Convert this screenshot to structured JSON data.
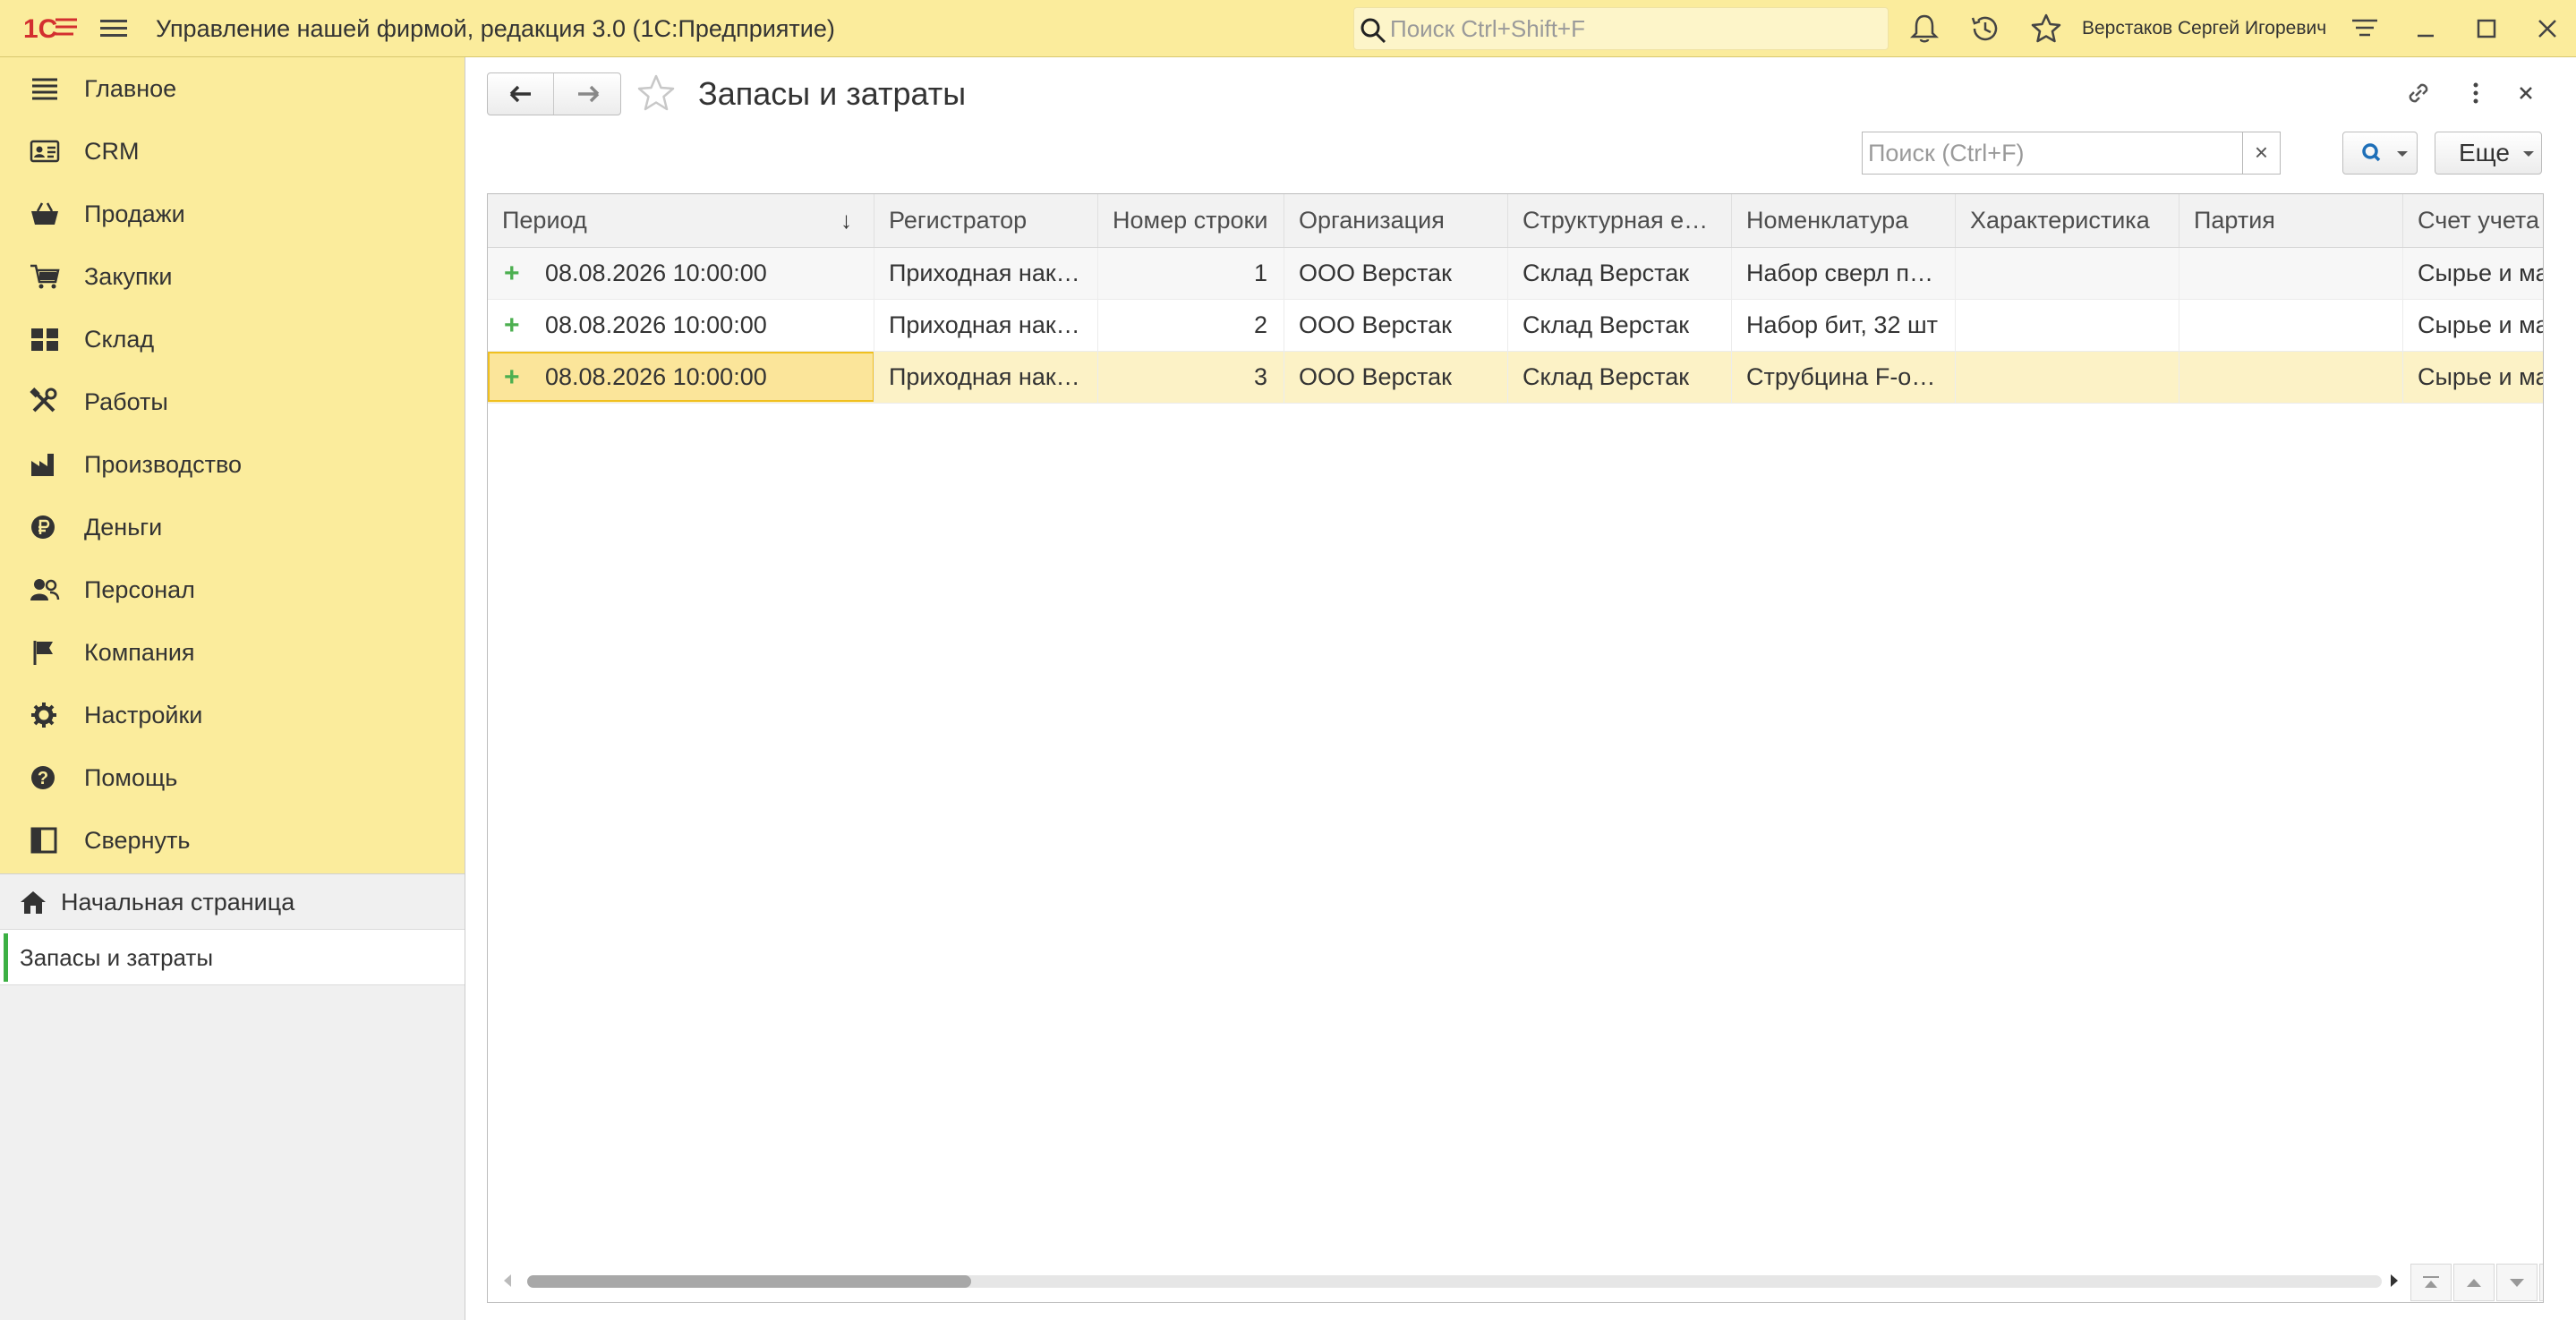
{
  "titlebar": {
    "app_title": "Управление нашей фирмой, редакция 3.0  (1С:Предприятие)",
    "search_placeholder": "Поиск Ctrl+Shift+F",
    "user_name": "Верстаков Сергей Игоревич"
  },
  "sidebar": {
    "items": [
      {
        "label": "Главное",
        "icon": "menu-lines-icon"
      },
      {
        "label": "CRM",
        "icon": "contact-card-icon"
      },
      {
        "label": "Продажи",
        "icon": "basket-icon"
      },
      {
        "label": "Закупки",
        "icon": "cart-icon"
      },
      {
        "label": "Склад",
        "icon": "warehouse-grid-icon"
      },
      {
        "label": "Работы",
        "icon": "tools-icon"
      },
      {
        "label": "Производство",
        "icon": "factory-icon"
      },
      {
        "label": "Деньги",
        "icon": "ruble-coin-icon"
      },
      {
        "label": "Персонал",
        "icon": "people-icon"
      },
      {
        "label": "Компания",
        "icon": "flag-icon"
      },
      {
        "label": "Настройки",
        "icon": "gear-icon"
      },
      {
        "label": "Помощь",
        "icon": "help-icon"
      },
      {
        "label": "Свернуть",
        "icon": "collapse-panel-icon"
      }
    ],
    "home_label": "Начальная страница",
    "open_tab_label": "Запасы и затраты"
  },
  "form": {
    "title": "Запасы и затраты",
    "search_placeholder": "Поиск (Ctrl+F)",
    "clear_label": "×",
    "more_label": "Еще"
  },
  "table": {
    "columns": [
      "Период",
      "Регистратор",
      "Номер строки",
      "Организация",
      "Структурная е…",
      "Номенклатура",
      "Характеристика",
      "Партия",
      "Счет учета"
    ],
    "sort_indicator": "↓",
    "rows": [
      {
        "mark": "+",
        "period": "08.08.2026 10:00:00",
        "registrar": "Приходная нак…",
        "line_no": "1",
        "organization": "ООО Верстак",
        "unit": "Склад Верстак",
        "nomenclature": "Набор сверл п…",
        "characteristic": "",
        "batch": "",
        "account": "Сырье и ма"
      },
      {
        "mark": "+",
        "period": "08.08.2026 10:00:00",
        "registrar": "Приходная нак…",
        "line_no": "2",
        "organization": "ООО Верстак",
        "unit": "Склад Верстак",
        "nomenclature": "Набор бит, 32 шт",
        "characteristic": "",
        "batch": "",
        "account": "Сырье и ма"
      },
      {
        "mark": "+",
        "period": "08.08.2026 10:00:00",
        "registrar": "Приходная нак…",
        "line_no": "3",
        "organization": "ООО Верстак",
        "unit": "Склад Верстак",
        "nomenclature": "Струбцина F-о…",
        "characteristic": "",
        "batch": "",
        "account": "Сырье и ма"
      }
    ],
    "selected_row": 2
  },
  "colors": {
    "panel_yellow": "#fbec9c",
    "selection": "#fcf2c6",
    "focus_border": "#f0c020",
    "row_mark_green": "#4caf50",
    "active_tab_bar": "#3cb043"
  }
}
